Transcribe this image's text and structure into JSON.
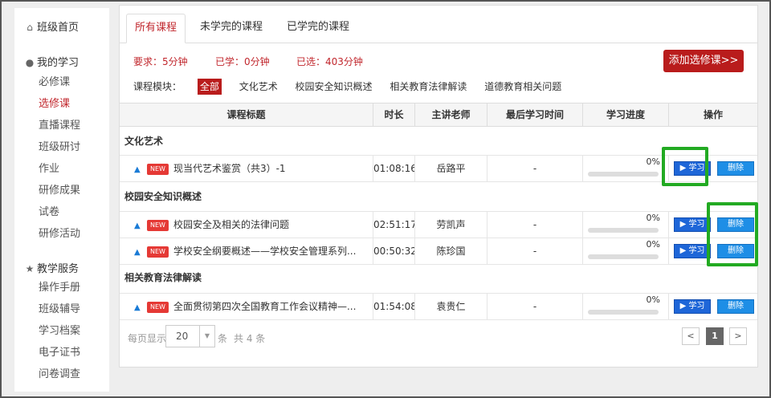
{
  "sidebar": {
    "home": {
      "icon": "home-icon",
      "label": "班级首页"
    },
    "my_study": {
      "icon": "user-icon",
      "label": "我的学习",
      "items": [
        "必修课",
        "选修课",
        "直播课程",
        "班级研讨",
        "作业",
        "研修成果",
        "试卷",
        "研修活动"
      ],
      "active": "选修课"
    },
    "teaching": {
      "icon": "star-icon",
      "label": "教学服务",
      "items": [
        "操作手册",
        "班级辅导",
        "学习档案",
        "电子证书",
        "问卷调查"
      ]
    }
  },
  "tabs": [
    "所有课程",
    "未学完的课程",
    "已学完的课程"
  ],
  "active_tab": "所有课程",
  "stats": {
    "required": "要求：5分钟",
    "learned": "已学：0分钟",
    "selected": "已选：403分钟"
  },
  "add_button": "添加选修课>>",
  "modules": {
    "label": "课程模块：",
    "items": [
      "全部",
      "文化艺术",
      "校园安全知识概述",
      "相关教育法律解读",
      "道德教育相关问题"
    ],
    "active": "全部"
  },
  "table": {
    "headers": [
      "课程标题",
      "时长",
      "主讲老师",
      "最后学习时间",
      "学习进度",
      "操作"
    ],
    "groups": [
      {
        "name": "文化艺术",
        "rows": [
          {
            "badge": "NEW",
            "title": "现当代艺术鉴赏（共3）-1",
            "duration": "01:08:16",
            "teacher": "岳路平",
            "last": "-",
            "progress": "0%",
            "progress_value": 0,
            "study": "学习",
            "delete": "删除"
          }
        ]
      },
      {
        "name": "校园安全知识概述",
        "rows": [
          {
            "badge": "NEW",
            "title": "校园安全及相关的法律问题",
            "duration": "02:51:17",
            "teacher": "劳凯声",
            "last": "-",
            "progress": "0%",
            "progress_value": 0,
            "study": "学习",
            "delete": "删除"
          },
          {
            "badge": "NEW",
            "title": "学校安全纲要概述——学校安全管理系列...",
            "duration": "00:50:32",
            "teacher": "陈珍国",
            "last": "-",
            "progress": "0%",
            "progress_value": 0,
            "study": "学习",
            "delete": "删除"
          }
        ]
      },
      {
        "name": "相关教育法律解读",
        "rows": [
          {
            "badge": "NEW",
            "title": "全面贯彻第四次全国教育工作会议精神—...",
            "duration": "01:54:08",
            "teacher": "袁贵仁",
            "last": "-",
            "progress": "0%",
            "progress_value": 0,
            "study": "学习",
            "delete": "删除"
          }
        ]
      }
    ]
  },
  "pager": {
    "per_page_label": "每页显示",
    "per_page": "20",
    "unit": "条",
    "total": "共 4 条",
    "prev": "<",
    "current": "1",
    "next": ">"
  },
  "colors": {
    "accent_red": "#b91c1c",
    "button_blue": "#1e66d8",
    "highlight_green": "#22aa22"
  }
}
